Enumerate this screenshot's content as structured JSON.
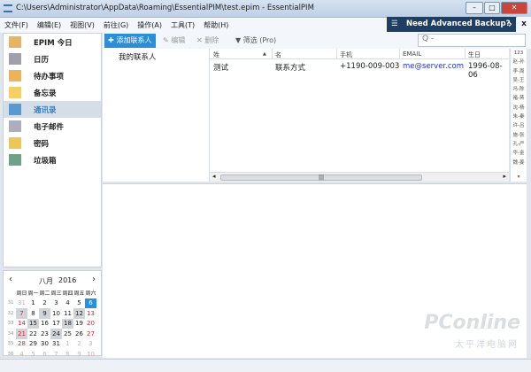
{
  "window": {
    "title": "C:\\Users\\Administrator\\AppData\\Roaming\\EssentialPIM\\test.epim - EssentialPIM"
  },
  "menu": [
    "文件(F)",
    "编辑(E)",
    "视图(V)",
    "前往(G)",
    "操作(A)",
    "工具(T)",
    "帮助(H)"
  ],
  "banner": {
    "text": "Need Advanced Backup?",
    "close": "x"
  },
  "sidebar": {
    "items": [
      {
        "label": "EPIM 今日",
        "icon": "home-icon"
      },
      {
        "label": "日历",
        "icon": "calendar-icon"
      },
      {
        "label": "待办事项",
        "icon": "todo-icon"
      },
      {
        "label": "备忘录",
        "icon": "note-icon"
      },
      {
        "label": "通讯录",
        "icon": "contacts-icon",
        "active": true
      },
      {
        "label": "电子邮件",
        "icon": "email-icon"
      },
      {
        "label": "密码",
        "icon": "key-icon"
      },
      {
        "label": "垃圾箱",
        "icon": "trash-icon"
      }
    ]
  },
  "toolbar": {
    "add": "添加联系人",
    "edit": "编辑",
    "delete": "删除",
    "filter": "筛选 (Pro)",
    "search_placeholder": "Q -"
  },
  "groups": {
    "label": "我的联系人"
  },
  "table": {
    "columns": [
      "姓",
      "名",
      "手机",
      "EMAIL",
      "生日"
    ],
    "rows": [
      [
        "测试",
        "联系方式",
        "+1190-009-003",
        "me@server.com",
        "1996-08-06"
      ]
    ]
  },
  "index": [
    "123",
    "赵-孙",
    "李-周",
    "吴-王",
    "冯-陈",
    "褚-蒋",
    "沈-杨",
    "朱-秦",
    "许-吕",
    "施-张",
    "孔-严",
    "华-金",
    "魏-姜"
  ],
  "calendar": {
    "month": "八月",
    "year": "2016",
    "weekdays": [
      "周日",
      "周一",
      "周二",
      "周三",
      "周四",
      "周五",
      "周六"
    ],
    "weeks": [
      {
        "n": "31",
        "d": [
          "31",
          "1",
          "2",
          "3",
          "4",
          "5",
          "6"
        ]
      },
      {
        "n": "32",
        "d": [
          "7",
          "8",
          "9",
          "10",
          "11",
          "12",
          "13"
        ]
      },
      {
        "n": "33",
        "d": [
          "14",
          "15",
          "16",
          "17",
          "18",
          "19",
          "20"
        ]
      },
      {
        "n": "34",
        "d": [
          "21",
          "22",
          "23",
          "24",
          "25",
          "26",
          "27"
        ]
      },
      {
        "n": "35",
        "d": [
          "28",
          "29",
          "30",
          "31",
          "1",
          "2",
          "3"
        ]
      },
      {
        "n": "36",
        "d": [
          "4",
          "5",
          "6",
          "7",
          "8",
          "9",
          "10"
        ]
      }
    ],
    "today": "6",
    "highlighted": [
      "7",
      "9",
      "12",
      "15",
      "18",
      "21",
      "24"
    ]
  },
  "colors": {
    "accent": "#2c8ed6",
    "banner": "#1f3e63",
    "weekend": "#dd2233"
  },
  "watermark": {
    "text": "PConline",
    "sub": "太平洋电脑网"
  }
}
